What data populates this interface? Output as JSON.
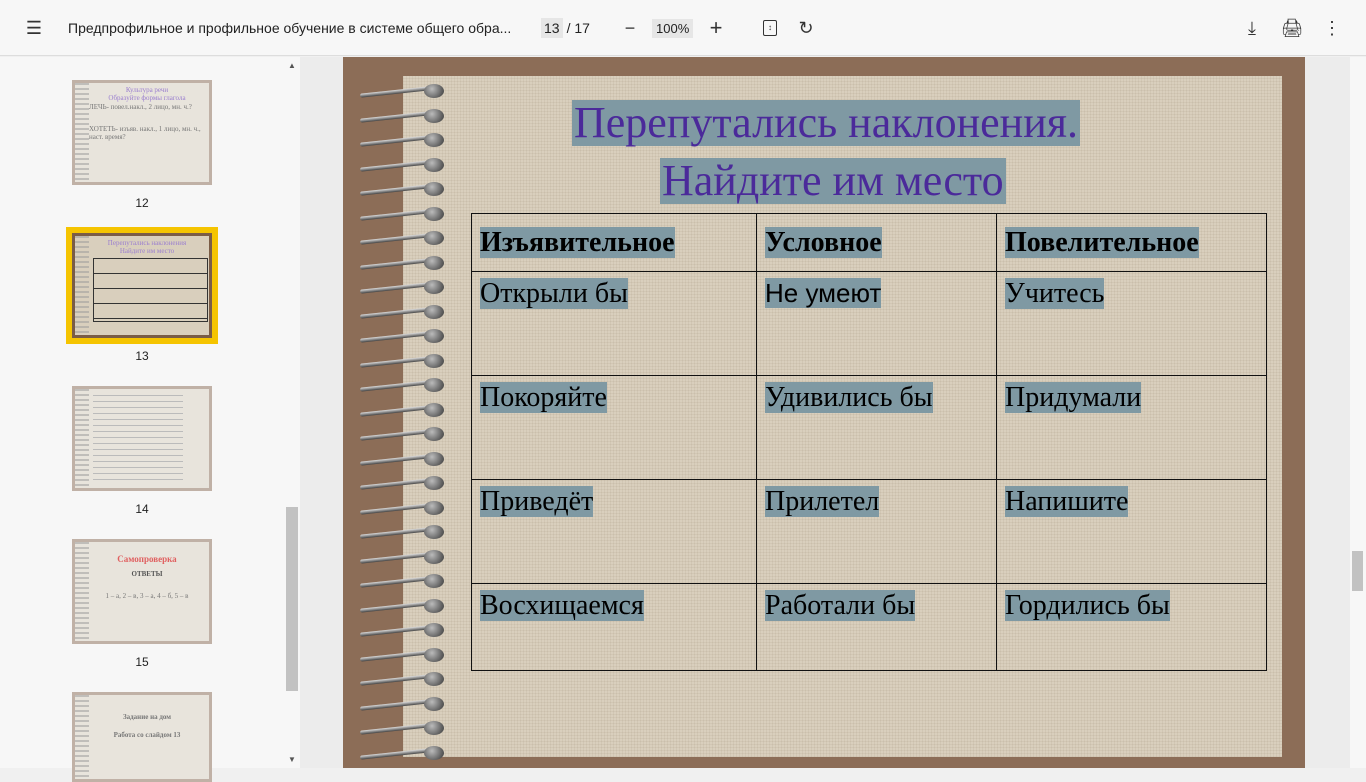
{
  "toolbar": {
    "title": "Предпрофильное и профильное обучение в системе общего обра...",
    "page_current": "13",
    "page_total": "/ 17",
    "zoom": "100%"
  },
  "thumbnails": [
    {
      "num": "12",
      "lines": [
        "Культура речи",
        "Образуйте формы глагола",
        "ЛЕЧЬ- повел.накл., 2 лицо, мн. ч.?",
        "ХОТЕТЬ- изъяв. накл., 1 лицо, мн. ч., наст. время?"
      ]
    },
    {
      "num": "13",
      "lines": [
        "Перепутались наклонения",
        "Найдите им место"
      ]
    },
    {
      "num": "14",
      "lines": []
    },
    {
      "num": "15",
      "lines": [
        "Самопроверка",
        "ОТВЕТЫ",
        "1 – а, 2 – в, 3 – а, 4 – б, 5 – в"
      ]
    },
    {
      "num": "",
      "lines": [
        "Задание на дом",
        "Работа со слайдом 13"
      ]
    }
  ],
  "slide": {
    "title_line1": "Перепутались наклонения.",
    "title_line2": "Найдите им место",
    "headers": [
      "Изъявительное",
      "Условное",
      "Повелительное"
    ],
    "rows": [
      [
        "Открыли бы",
        "Не умеют",
        "Учитесь"
      ],
      [
        "Покоряйте",
        "Удивились бы",
        "Придумали"
      ],
      [
        "Приведёт",
        "Прилетел",
        "Напишите"
      ],
      [
        "Восхищаемся",
        "Работали бы",
        "Гордились бы"
      ]
    ]
  }
}
